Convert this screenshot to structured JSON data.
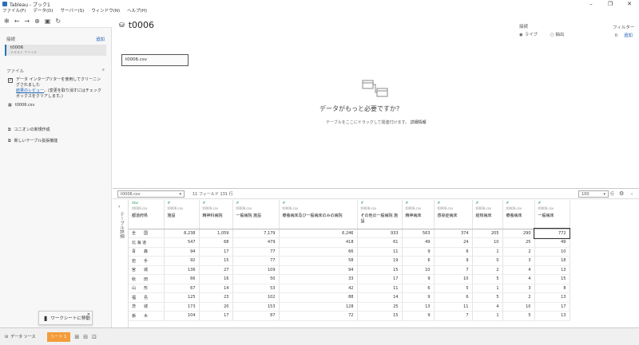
{
  "window": {
    "title": "Tableau - ブック1"
  },
  "menu": [
    "ファイル(F)",
    "データ(D)",
    "サーバー(S)",
    "ウィンドウ(N)",
    "ヘルプ(H)"
  ],
  "left": {
    "connections_label": "接続",
    "add_label": "追加",
    "connection_name": "t0006",
    "connection_type": "テキスト ファイル",
    "files_label": "ファイル",
    "interpreter_text": "データ インタープリターを使用してクリーニングされました",
    "review_link": "結果のレビュー",
    "interpreter_note": "。(変更を取り消すにはチェック ボックスをクリアします。)",
    "file_name": "t0006.csv",
    "union_label": "ユニオンの新規作成",
    "extension_label": "新しいテーブル拡張機能"
  },
  "canvas": {
    "title": "t0006",
    "connection_label": "接続",
    "live_label": "ライブ",
    "extract_label": "抽出",
    "filter_label": "フィルター",
    "filter_count": "0",
    "filter_add": "追加",
    "table_name": "t0006.csv",
    "need_more": "データがもっと必要ですか?",
    "drag_hint": "テーブルをここにドラッグして関連付けます。",
    "learn_more": "詳細情報"
  },
  "grid": {
    "table_select": "t0006.csv",
    "summary": "11 フィールド 131 行",
    "rows_value": "100",
    "rows_label": "行",
    "side_label": "テーブル詳細",
    "columns": [
      {
        "type": "Abc",
        "src": "t0006.csv",
        "name": "都道府県"
      },
      {
        "type": "#",
        "src": "t0006.csv",
        "name": "施設"
      },
      {
        "type": "#",
        "src": "t0006.csv",
        "name": "精神科病院"
      },
      {
        "type": "#",
        "src": "t0006.csv",
        "name": "一般病院 施設"
      },
      {
        "type": "#",
        "src": "t0006.csv",
        "name": "療養病床及び一般病床のみの病院"
      },
      {
        "type": "#",
        "src": "t0006.csv",
        "name": "その他の一般病院 施設"
      },
      {
        "type": "#",
        "src": "t0006.csv",
        "name": "精神病床"
      },
      {
        "type": "#",
        "src": "t0006.csv",
        "name": "感染症病床"
      },
      {
        "type": "#",
        "src": "t0006.csv",
        "name": "結核病床"
      },
      {
        "type": "#",
        "src": "t0006.csv",
        "name": "療養病床"
      },
      {
        "type": "#",
        "src": "t0006.csv",
        "name": "一般病床"
      }
    ],
    "rows": [
      [
        "全　　国",
        "8,238",
        "1,059",
        "7,179",
        "6,246",
        "933",
        "563",
        "374",
        "205",
        "290",
        "772"
      ],
      [
        "北 海 道",
        "547",
        "68",
        "479",
        "418",
        "61",
        "49",
        "24",
        "10",
        "25",
        "49"
      ],
      [
        "青　　森",
        "94",
        "17",
        "77",
        "66",
        "11",
        "9",
        "6",
        "1",
        "2",
        "10"
      ],
      [
        "岩　　手",
        "92",
        "15",
        "77",
        "58",
        "19",
        "6",
        "9",
        "0",
        "3",
        "18"
      ],
      [
        "宮　　城",
        "136",
        "27",
        "109",
        "94",
        "15",
        "10",
        "7",
        "2",
        "4",
        "13"
      ],
      [
        "秋　　田",
        "66",
        "16",
        "50",
        "33",
        "17",
        "9",
        "10",
        "5",
        "4",
        "15"
      ],
      [
        "山　　形",
        "67",
        "14",
        "53",
        "42",
        "11",
        "6",
        "5",
        "1",
        "3",
        "8"
      ],
      [
        "福　　島",
        "125",
        "23",
        "102",
        "88",
        "14",
        "9",
        "6",
        "5",
        "2",
        "13"
      ],
      [
        "茨　　城",
        "173",
        "20",
        "153",
        "128",
        "25",
        "13",
        "11",
        "4",
        "10",
        "17"
      ],
      [
        "栃　　木",
        "104",
        "17",
        "87",
        "72",
        "15",
        "9",
        "7",
        "1",
        "5",
        "13"
      ]
    ]
  },
  "bottom": {
    "datasource_tab": "データ ソース",
    "sheet_tab": "シート 1",
    "goto_worksheet": "ワークシートに移動"
  }
}
